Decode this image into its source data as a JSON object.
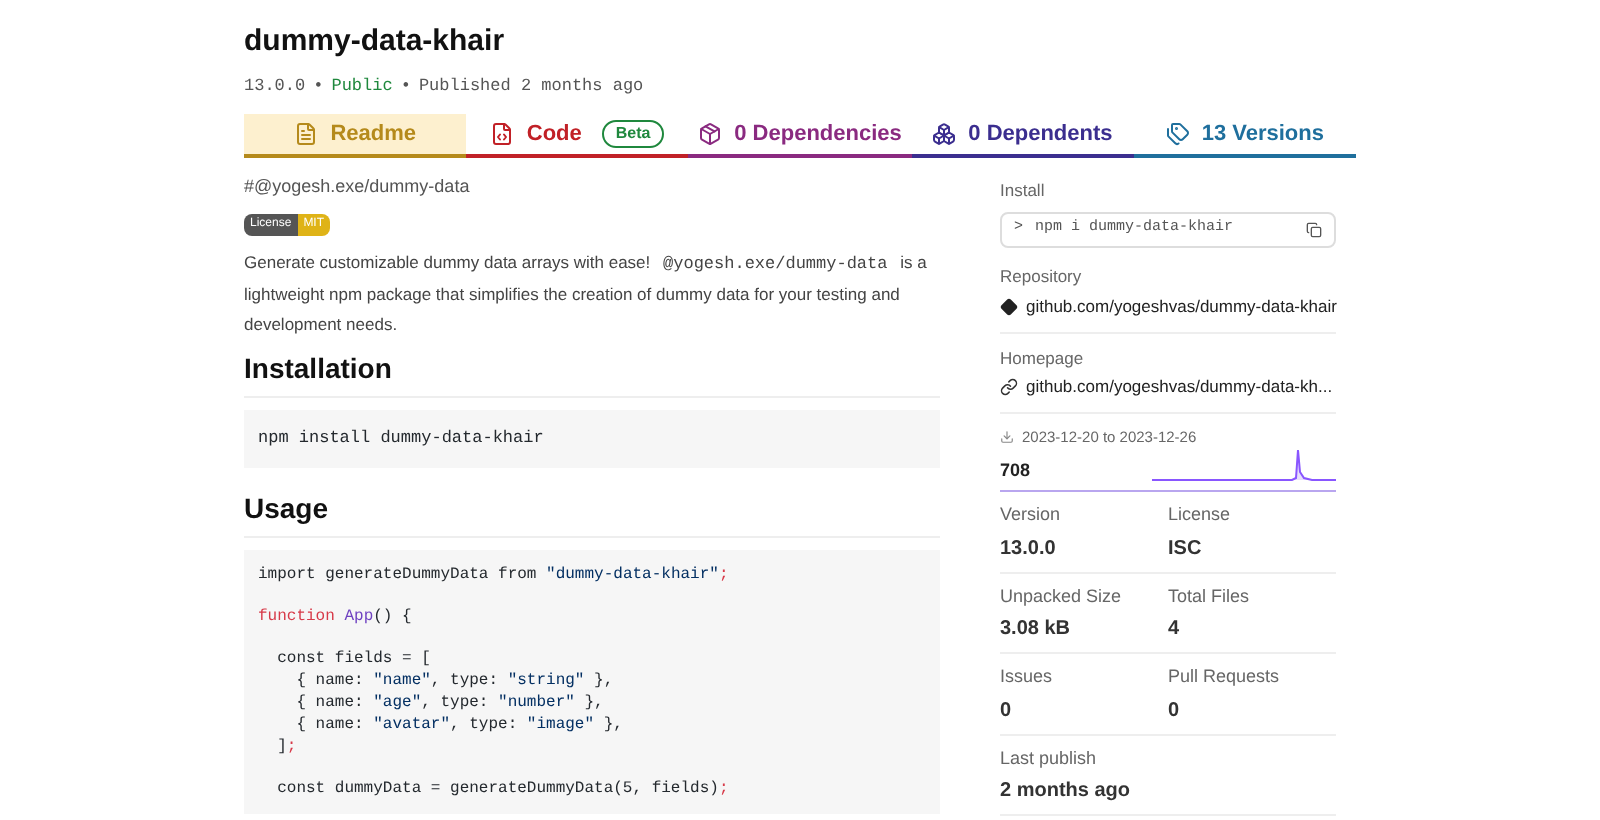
{
  "package": {
    "name": "dummy-data-khair",
    "version": "13.0.0",
    "separator_1": "•",
    "visibility": "Public",
    "separator_2": "•",
    "published": "Published 2 months ago"
  },
  "tabs": [
    {
      "label": "Readme",
      "kind": "file",
      "selected": true,
      "color": "#b58a1b"
    },
    {
      "label": "Code",
      "kind": "code",
      "selected": false,
      "color": "#c12127",
      "badge": "Beta"
    },
    {
      "label": "0 Dependencies",
      "kind": "box",
      "selected": false,
      "color": "#8a2a80"
    },
    {
      "label": "0 Dependents",
      "kind": "boxes",
      "selected": false,
      "color": "#3b2e8f"
    },
    {
      "label": "13 Versions",
      "kind": "tags",
      "selected": false,
      "color": "#1f6f9d"
    }
  ],
  "readme": {
    "scope": "#@yogesh.exe/dummy-data",
    "license_badge": {
      "label": "License",
      "value": "MIT"
    },
    "intro_parts": [
      {
        "kind": "text",
        "text": "Generate customizable dummy data arrays with ease! "
      },
      {
        "kind": "code",
        "text": "@yogesh.exe/dummy-data"
      },
      {
        "kind": "text",
        "text": " is a lightweight npm package that simplifies the creation of dummy data for your testing and development needs."
      }
    ],
    "installation_heading": "Installation",
    "install_code": "npm install dummy-data-khair",
    "usage_heading": "Usage",
    "usage_code": [
      {
        "kind": "code",
        "tokens": [
          {
            "kind": "plain",
            "text": "import generateDummyData from "
          },
          {
            "kind": "string",
            "text": "\"dummy-data-khair\""
          },
          {
            "kind": "keyword",
            "text": ";"
          }
        ]
      },
      {
        "kind": "blank"
      },
      {
        "kind": "code",
        "tokens": [
          {
            "kind": "keyword",
            "text": "function "
          },
          {
            "kind": "name",
            "text": "App"
          },
          {
            "kind": "plain",
            "text": "() {"
          }
        ]
      },
      {
        "kind": "blank"
      },
      {
        "kind": "code",
        "tokens": [
          {
            "kind": "plain",
            "text": "  const fields = ["
          }
        ]
      },
      {
        "kind": "code",
        "tokens": [
          {
            "kind": "plain",
            "text": "    { name: "
          },
          {
            "kind": "string",
            "text": "\"name\""
          },
          {
            "kind": "plain",
            "text": ", type: "
          },
          {
            "kind": "string",
            "text": "\"string\""
          },
          {
            "kind": "plain",
            "text": " },"
          }
        ]
      },
      {
        "kind": "code",
        "tokens": [
          {
            "kind": "plain",
            "text": "    { name: "
          },
          {
            "kind": "string",
            "text": "\"age\""
          },
          {
            "kind": "plain",
            "text": ", type: "
          },
          {
            "kind": "string",
            "text": "\"number\""
          },
          {
            "kind": "plain",
            "text": " },"
          }
        ]
      },
      {
        "kind": "code",
        "tokens": [
          {
            "kind": "plain",
            "text": "    { name: "
          },
          {
            "kind": "string",
            "text": "\"avatar\""
          },
          {
            "kind": "plain",
            "text": ", type: "
          },
          {
            "kind": "string",
            "text": "\"image\""
          },
          {
            "kind": "plain",
            "text": " },"
          }
        ]
      },
      {
        "kind": "code",
        "tokens": [
          {
            "kind": "plain",
            "text": "  ]"
          },
          {
            "kind": "keyword",
            "text": ";"
          }
        ]
      },
      {
        "kind": "blank"
      },
      {
        "kind": "code",
        "tokens": [
          {
            "kind": "plain",
            "text": "  const dummyData = generateDummyData(5, fields)"
          },
          {
            "kind": "keyword",
            "text": ";"
          }
        ]
      }
    ]
  },
  "sidebar": {
    "install": {
      "label": "Install",
      "prompt": ">",
      "command": "npm i dummy-data-khair"
    },
    "repository": {
      "label": "Repository",
      "link": "github.com/yogeshvas/dummy-data-khair"
    },
    "homepage": {
      "label": "Homepage",
      "link": "github.com/yogeshvas/dummy-data-kh..."
    },
    "downloads": {
      "range": "2023-12-20 to 2023-12-26",
      "count": "708"
    },
    "stats": [
      [
        {
          "label": "Version",
          "value": "13.0.0"
        },
        {
          "label": "License",
          "value": "ISC"
        }
      ],
      [
        {
          "label": "Unpacked Size",
          "value": "3.08 kB"
        },
        {
          "label": "Total Files",
          "value": "4"
        }
      ],
      [
        {
          "label": "Issues",
          "value": "0"
        },
        {
          "label": "Pull Requests",
          "value": "0"
        }
      ],
      [
        {
          "label": "Last publish",
          "value": "2 months ago"
        }
      ]
    ]
  }
}
